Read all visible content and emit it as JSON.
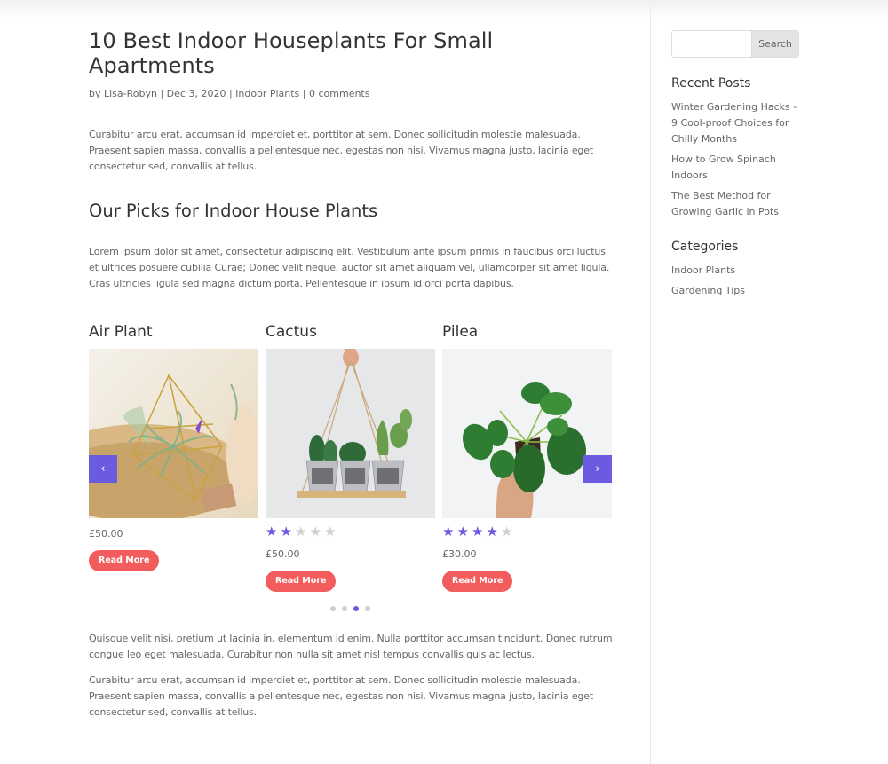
{
  "post": {
    "title": "10 Best Indoor Houseplants For Small Apartments",
    "meta": {
      "by": "by ",
      "author": "Lisa-Robyn",
      "sep": " | ",
      "date": "Dec 3, 2020",
      "category": "Indoor Plants",
      "comments": "0 comments"
    },
    "intro": "Curabitur arcu erat, accumsan id imperdiet et, porttitor at sem. Donec sollicitudin molestie malesuada. Praesent sapien massa, convallis a pellentesque nec, egestas non nisi. Vivamus magna justo, lacinia eget consectetur sed, convallis at tellus.",
    "section_heading": "Our Picks for Indoor House Plants",
    "section_para": "Lorem ipsum dolor sit amet, consectetur adipiscing elit. Vestibulum ante ipsum primis in faucibus orci luctus et ultrices posuere cubilia Curae; Donec velit neque, auctor sit amet aliquam vel, ullamcorper sit amet ligula. Cras ultricies ligula sed magna dictum porta. Pellentesque in ipsum id orci porta dapibus.",
    "outro_1": "Quisque velit nisi, pretium ut lacinia in, elementum id enim. Nulla porttitor accumsan tincidunt. Donec rutrum congue leo eget malesuada. Curabitur non nulla sit amet nisl tempus convallis quis ac lectus.",
    "outro_2": "Curabitur arcu erat, accumsan id imperdiet et, porttitor at sem. Donec sollicitudin molestie malesuada. Praesent sapien massa, convallis a pellentesque nec, egestas non nisi. Vivamus magna justo, lacinia eget consectetur sed, convallis at tellus."
  },
  "carousel": {
    "prev_icon": "‹",
    "next_icon": "›",
    "products": [
      {
        "title": "Air Plant",
        "image": "air-plant-terrarium-photo",
        "rating": null,
        "price": "£50.00",
        "button": "Read More"
      },
      {
        "title": "Cactus",
        "image": "hanging-cactus-shelf-photo",
        "rating": 2,
        "max_rating": 5,
        "price": "£50.00",
        "button": "Read More"
      },
      {
        "title": "Pilea",
        "image": "pilea-in-hand-photo",
        "rating": 4,
        "max_rating": 5,
        "price": "£30.00",
        "button": "Read More"
      }
    ],
    "dots_total": 4,
    "dots_active_index": 2,
    "star_glyph": "★"
  },
  "sidebar": {
    "search": {
      "placeholder": "",
      "value": "",
      "button": "Search"
    },
    "recent_posts": {
      "title": "Recent Posts",
      "items": [
        "Winter Gardening Hacks - 9 Cool-proof Choices for Chilly Months",
        "How to Grow Spinach Indoors",
        "The Best Method for Growing Garlic in Pots"
      ]
    },
    "categories": {
      "title": "Categories",
      "items": [
        "Indoor Plants",
        "Gardening Tips"
      ]
    }
  },
  "colors": {
    "accent": "#6b5be0",
    "button": "#f25c5c",
    "star_empty": "#cfcfcf",
    "heading": "#333333",
    "body_text": "#666666"
  }
}
